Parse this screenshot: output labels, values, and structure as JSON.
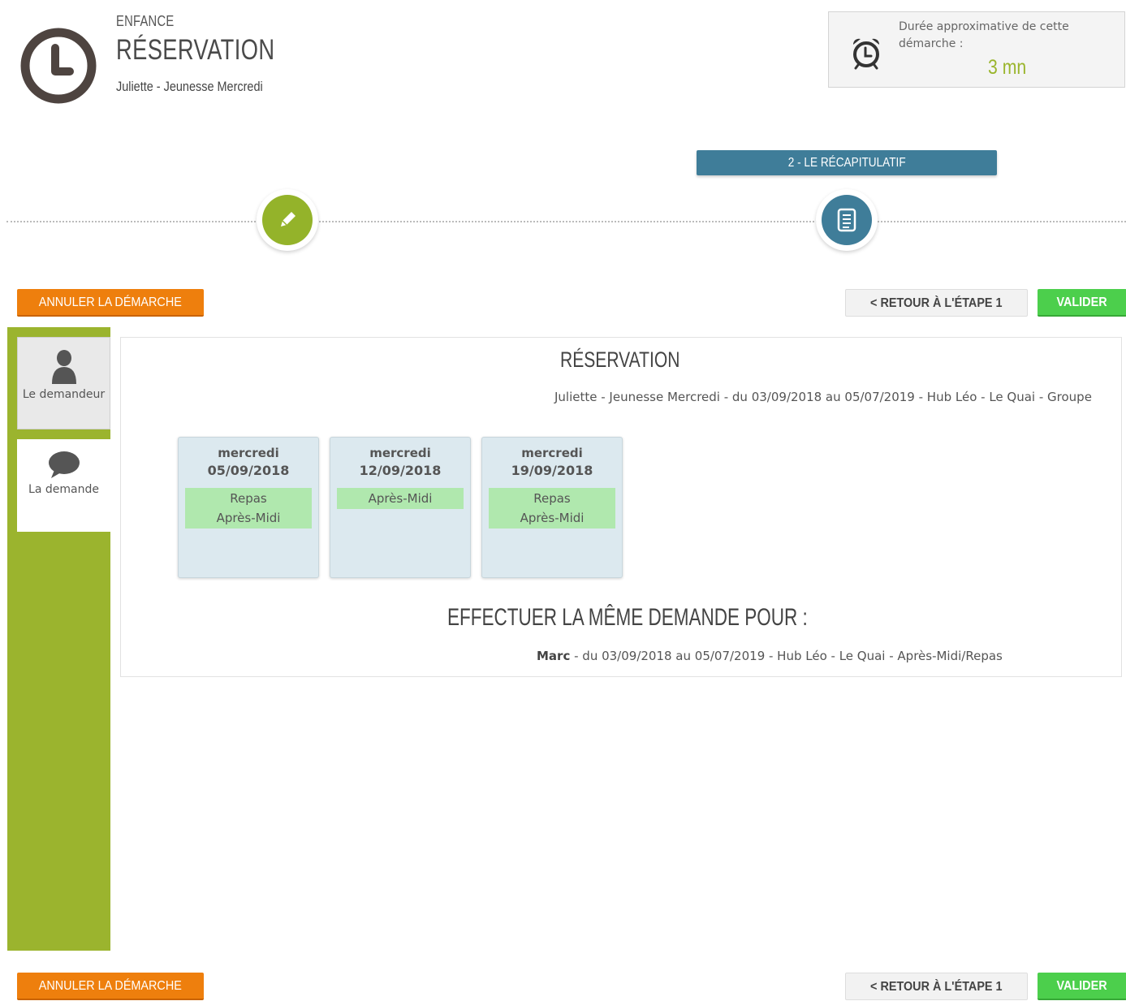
{
  "header": {
    "category": "ENFANCE",
    "title": "RÉSERVATION",
    "subtitle": "Juliette - Jeunesse Mercredi"
  },
  "duration": {
    "label": "Durée approximative de cette démarche :",
    "value": "3 mn"
  },
  "steps": {
    "active_label": "2 - LE RÉCAPITULATIF",
    "items": [
      {
        "icon": "pencil-icon",
        "color": "#94b32a"
      },
      {
        "icon": "document-list-icon",
        "color": "#3f7d99"
      }
    ]
  },
  "actions": {
    "cancel_label": "ANNULER LA DÉMARCHE",
    "back_label": "< RETOUR À L'ÉTAPE 1",
    "validate_label": "VALIDER"
  },
  "sidebar": {
    "items": [
      {
        "label": "Le demandeur",
        "icon": "user-icon"
      },
      {
        "label": "La demande",
        "icon": "speech-bubble-icon"
      }
    ]
  },
  "reservation": {
    "title": "RÉSERVATION",
    "description": "Juliette - Jeunesse Mercredi - du 03/09/2018 au 05/07/2019 - Hub Léo - Le Quai - Groupe",
    "days": [
      {
        "day": "mercredi",
        "date": "05/09/2018",
        "slots": [
          "Repas",
          "Après-Midi"
        ]
      },
      {
        "day": "mercredi",
        "date": "12/09/2018",
        "slots": [
          "Après-Midi"
        ]
      },
      {
        "day": "mercredi",
        "date": "19/09/2018",
        "slots": [
          "Repas",
          "Après-Midi"
        ]
      }
    ]
  },
  "same_request": {
    "title": "EFFECTUER LA MÊME DEMANDE POUR :",
    "person": "Marc",
    "details": " - du 03/09/2018 au 05/07/2019 - Hub Léo - Le Quai - Après-Midi/Repas"
  },
  "colors": {
    "brand_green": "#9bb42e",
    "step_blue": "#3f7d99",
    "cancel_orange": "#ee7f0d",
    "validate_green": "#4ccf4c",
    "slot_green": "#b0e8ae"
  }
}
